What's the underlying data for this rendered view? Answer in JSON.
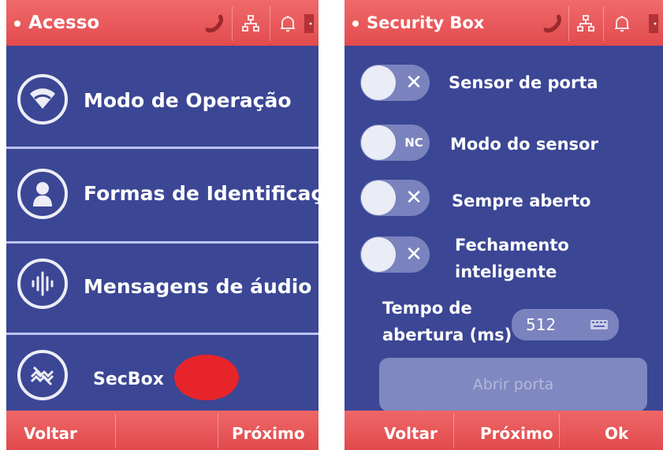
{
  "colors": {
    "screen_bg": "#3b4695",
    "bar_red": "#e85558",
    "redaction": "#e8242b"
  },
  "left_panel": {
    "title": "Acesso",
    "status_icons": [
      "phone-icon",
      "network-icon",
      "bell-icon",
      "door-icon"
    ],
    "menu_items": [
      {
        "label": "Modo de Operação",
        "icon": "wifi-icon"
      },
      {
        "label": "Formas de Identificação",
        "icon": "person-icon"
      },
      {
        "label": "Mensagens de áudio",
        "icon": "audio-wave-icon"
      },
      {
        "label": "SecBox",
        "icon": "secbox-icon"
      }
    ],
    "nav": {
      "back": "Voltar",
      "next": "Próximo"
    }
  },
  "right_panel": {
    "title": "Security Box",
    "status_icons": [
      "phone-icon",
      "network-icon",
      "bell-icon",
      "door-icon"
    ],
    "settings": [
      {
        "label": "Sensor de porta",
        "state": "✕",
        "on": false
      },
      {
        "label": "Modo do sensor",
        "state": "NC",
        "on": false
      },
      {
        "label": "Sempre aberto",
        "state": "✕",
        "on": false
      },
      {
        "label": "Fechamento inteligente",
        "line1": "Fechamento",
        "line2": "inteligente",
        "state": "✕",
        "on": false
      }
    ],
    "open_time": {
      "label_line1": "Tempo de",
      "label_line2": "abertura (ms)",
      "value": "512"
    },
    "open_door_button": "Abrir porta",
    "nav": {
      "back": "Voltar",
      "next": "Próximo",
      "ok": "Ok"
    }
  }
}
